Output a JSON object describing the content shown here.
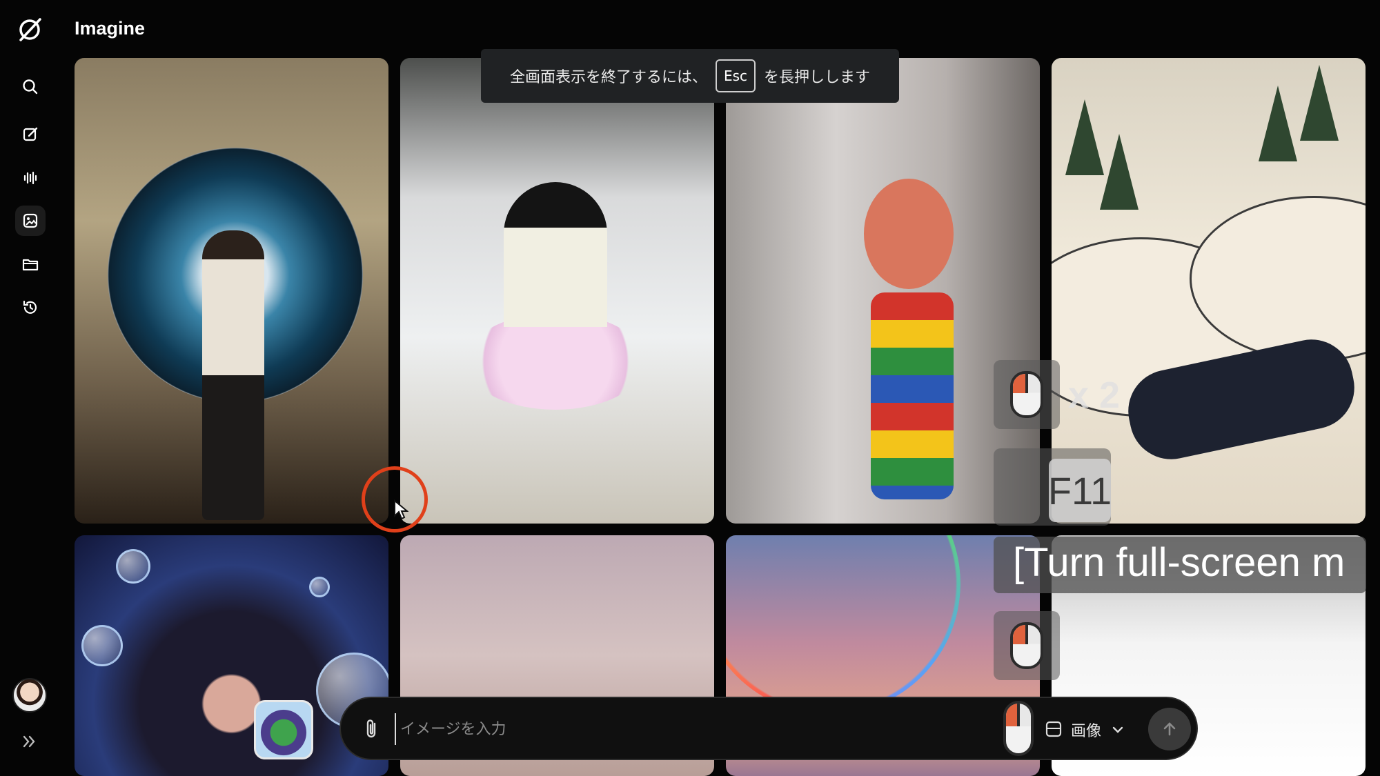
{
  "app": {
    "title": "Imagine"
  },
  "sidebar": {
    "items": [
      {
        "name": "search",
        "icon": "search-icon"
      },
      {
        "name": "edit",
        "icon": "edit-icon"
      },
      {
        "name": "voice",
        "icon": "waveform-icon"
      },
      {
        "name": "imagine",
        "icon": "image-gallery-icon",
        "active": true
      },
      {
        "name": "files",
        "icon": "folder-icon"
      },
      {
        "name": "history",
        "icon": "history-icon"
      }
    ],
    "expand_icon": "double-chevron-right-icon"
  },
  "toast": {
    "before": "全画面表示を終了するには、",
    "key": "Esc",
    "after": "を長押しします"
  },
  "overlay": {
    "click_count": "x 2",
    "key": "F11",
    "caption": "[Turn full-screen m"
  },
  "prompt": {
    "placeholder": "イメージを入力",
    "mode_label": "画像",
    "attach_icon": "paperclip-icon",
    "send_icon": "arrow-up-icon"
  },
  "gallery": {
    "tiles": [
      "man-entering-portal",
      "penguin-in-tutu",
      "clay-puppet-waving",
      "snowy-hills-sledding-kid",
      "girl-with-bubbles",
      "pastel-cloud",
      "rainbow-sky",
      "white-foggy"
    ]
  },
  "colors": {
    "background": "#050505",
    "accent_cursor": "#e0401a",
    "prompt_bg": "#101010"
  }
}
